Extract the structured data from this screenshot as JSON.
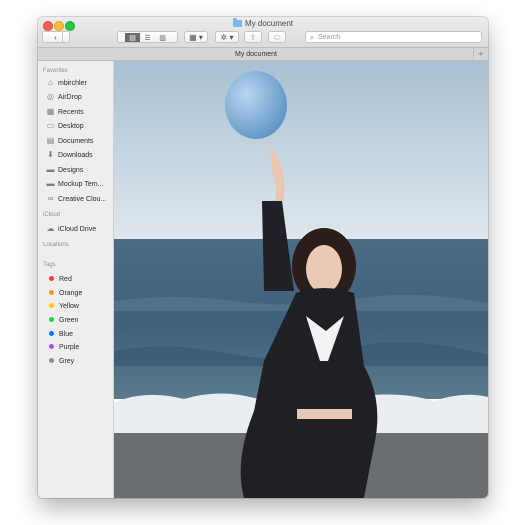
{
  "window": {
    "title": "My document"
  },
  "toolbar": {
    "back": "‹",
    "forward": "›",
    "view_icons": "▤",
    "view_list": "☰",
    "view_columns": "▥",
    "view_gallery": "▭",
    "group": "▦ ▾",
    "action": "✲ ▾",
    "share": "⇪",
    "tag": "⬭"
  },
  "search": {
    "placeholder": "Search",
    "value": ""
  },
  "tab": {
    "title": "My document",
    "add": "+"
  },
  "sidebar": {
    "favorites_label": "Favorites",
    "favorites": [
      {
        "label": "mbirchler",
        "icon": "home-icon"
      },
      {
        "label": "AirDrop",
        "icon": "airdrop-icon"
      },
      {
        "label": "Recents",
        "icon": "recents-icon"
      },
      {
        "label": "Desktop",
        "icon": "desktop-icon"
      },
      {
        "label": "Documents",
        "icon": "documents-icon"
      },
      {
        "label": "Downloads",
        "icon": "downloads-icon"
      },
      {
        "label": "Designs",
        "icon": "folder-icon"
      },
      {
        "label": "Mockup Tem...",
        "icon": "folder-icon"
      },
      {
        "label": "Creative Clou...",
        "icon": "creative-cloud-icon"
      }
    ],
    "icloud_label": "iCloud",
    "icloud": [
      {
        "label": "iCloud Drive",
        "icon": "cloud-icon"
      }
    ],
    "locations_label": "Locations",
    "tags_label": "Tags",
    "tags": [
      {
        "label": "Red",
        "color": "#ff3b30"
      },
      {
        "label": "Orange",
        "color": "#ff9500"
      },
      {
        "label": "Yellow",
        "color": "#ffcc00"
      },
      {
        "label": "Green",
        "color": "#28cd41"
      },
      {
        "label": "Blue",
        "color": "#007aff"
      },
      {
        "label": "Purple",
        "color": "#af52de"
      },
      {
        "label": "Grey",
        "color": "#8e8e93"
      }
    ]
  },
  "content": {
    "image": "photo-woman-with-balloon-at-beach"
  }
}
